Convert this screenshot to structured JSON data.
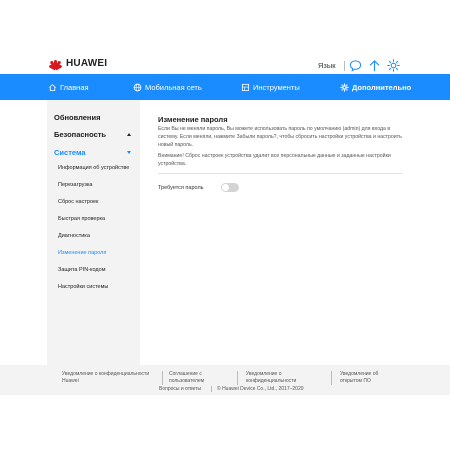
{
  "header": {
    "brand": "HUAWEI",
    "language_label": "Язык"
  },
  "nav": {
    "items": [
      {
        "label": "Главная",
        "icon": "home-icon"
      },
      {
        "label": "Мобильная сеть",
        "icon": "globe-icon"
      },
      {
        "label": "Инструменты",
        "icon": "toolbox-icon"
      },
      {
        "label": "Дополнительно",
        "icon": "gear-icon",
        "active": true
      }
    ]
  },
  "sidebar": {
    "sections": [
      {
        "label": "Обновления",
        "expanded": false
      },
      {
        "label": "Безопасность",
        "expanded": false
      },
      {
        "label": "Система",
        "expanded": true,
        "selected": true
      }
    ],
    "sub_items": [
      "Информация об устройстве",
      "Перезагрузка",
      "Сброс настроек",
      "Быстрая проверка",
      "Диагностика",
      "Изменение пароля",
      "Защита PIN-кодом",
      "Настройки системы"
    ],
    "selected_sub_item": "Изменение пароля"
  },
  "main": {
    "title": "Изменение пароля",
    "description_lines": [
      "Если Вы не меняли пароль, Вы можете использовать пароль по умолчанию (admin) для входа в",
      "систему. Если меняли, нажмите Забыли пароль?, чтобы сбросить настройки устройства и настроить",
      "новый пароль."
    ],
    "warning_lines": [
      "Внимание! Сброс настроек устройства удалит все персональные данные и заданные настройки",
      "устройства."
    ],
    "password_required_label": "Требуется пароль",
    "password_required_enabled": false
  },
  "footer": {
    "links": [
      [
        "Уведомление о конфиденциальности",
        "Huawei"
      ],
      [
        "Соглашение с",
        "пользователем"
      ],
      [
        "Уведомление о",
        "конфиденциальности"
      ],
      [
        "Уведомление об",
        "открытом ПО"
      ]
    ],
    "faq": "Вопросы и ответы",
    "copyright": "© Huawei Device Co., Ltd., 2017–2020"
  },
  "colors": {
    "accent": "#1a8cff",
    "logo_red": "#d71920",
    "sidebar_bg": "#f3f3f3"
  }
}
